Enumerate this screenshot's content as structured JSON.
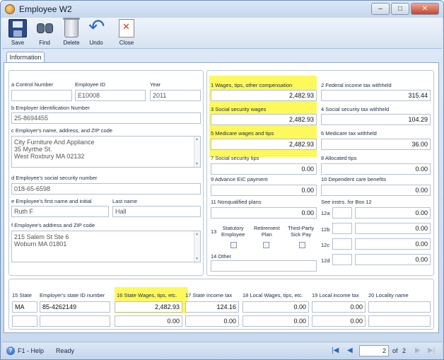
{
  "window": {
    "title": "Employee W2",
    "buttons": {
      "minimize": "–",
      "maximize": "□",
      "close": "✕"
    }
  },
  "toolbar": {
    "save": "Save",
    "find": "Find",
    "delete": "Delete",
    "undo": "Undo",
    "close": "Close"
  },
  "tab": {
    "label": "Information"
  },
  "employee": {
    "control_number_label": "a  Control Number",
    "control_number": "",
    "employee_id_label": "Employee ID",
    "employee_id": "E10008",
    "year_label": "Year",
    "year": "2011",
    "ein_label": "b  Employer Identification Number",
    "ein": "25-8694455",
    "employer_name_label": "c  Employer's name, address, and ZIP code",
    "employer_name": "City Furniture And Appliance\n35 Myrthe St.\nWest Roxbury MA 02132",
    "ssn_label": "d  Employee's social security number",
    "ssn": "018-65-6598",
    "first_name_label": "e  Employee's first name and initial",
    "first_name": "Ruth F",
    "last_name_label": "Last name",
    "last_name": "Hall",
    "address_label": "f  Employee's address and ZIP code",
    "address": "215 Salem St Ste 6\nWoburn MA 01801"
  },
  "boxes": {
    "b1_label": "1  Wages, tips, other compensation",
    "b1": "2,482.93",
    "b2_label": "2  Federal income tax withheld",
    "b2": "315.44",
    "b3_label": "3  Social security wages",
    "b3": "2,482.93",
    "b4_label": "4  Social security tax withheld",
    "b4": "104.29",
    "b5_label": "5  Medicare wages and tips",
    "b5": "2,482.93",
    "b6_label": "6  Medicare tax withheld",
    "b6": "36.00",
    "b7_label": "7  Social security tips",
    "b7": "0.00",
    "b8_label": "8  Allocated tips",
    "b8": "0.00",
    "b9_label": "9  Advance EIC payment",
    "b9": "0.00",
    "b10_label": "10  Dependent care benefits",
    "b10": "0.00",
    "b11_label": "11  Nonqualified plans",
    "b11": "0.00",
    "b12_label": "See instrs. for Box 12",
    "b12a_label": "12a",
    "b12a": "0.00",
    "b12b_label": "12b",
    "b12b": "0.00",
    "b12c_label": "12c",
    "b12c": "0.00",
    "b12d_label": "12d",
    "b12d": "0.00",
    "b13_label": "13",
    "statutory_label": "Statutory\nEmployee",
    "retirement_label": "Retirement\nPlan",
    "thirdparty_label": "Third-Party\nSick Pay",
    "b14_label": "14  Other",
    "b14": ""
  },
  "state": {
    "b15_label": "15  State",
    "state_id_label": "Employer's state ID number",
    "b16_label": "16  State Wages, tips, etc.",
    "b17_label": "17  State income tax",
    "b18_label": "18  Local Wages, tips, etc.",
    "b19_label": "19  Local income tax",
    "b20_label": "20  Locality name",
    "row1": {
      "state": "MA",
      "state_id": "85-4262149",
      "wages": "2,482.93",
      "tax": "124.16",
      "local_wages": "0.00",
      "local_tax": "0.00",
      "locality": ""
    },
    "row2": {
      "state": "",
      "state_id": "",
      "wages": "0.00",
      "tax": "0.00",
      "local_wages": "0.00",
      "local_tax": "0.00",
      "locality": ""
    }
  },
  "status": {
    "help": "F1 - Help",
    "state": "Ready",
    "page": "2",
    "of": "of",
    "total": "2"
  },
  "colors": {
    "highlight": "#fdf85c",
    "window_bg": "#c9d9ee"
  }
}
